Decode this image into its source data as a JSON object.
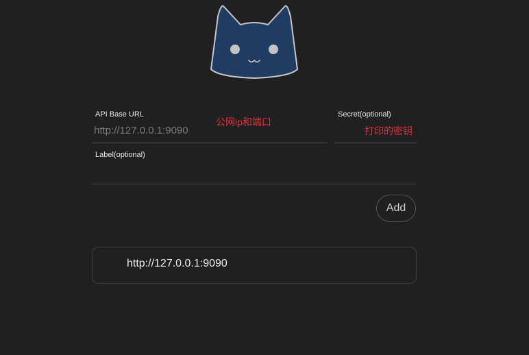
{
  "form": {
    "api_base_url": {
      "label": "API Base URL",
      "placeholder": "http://127.0.0.1:9090",
      "value": "",
      "annotation": "公网ip和端口"
    },
    "secret": {
      "label": "Secret(optional)",
      "placeholder": "",
      "value": "",
      "annotation": "打印的密钥"
    },
    "label": {
      "label": "Label(optional)",
      "placeholder": "",
      "value": ""
    },
    "add_button_label": "Add"
  },
  "backends": [
    {
      "url": "http://127.0.0.1:9090"
    }
  ],
  "colors": {
    "background": "#202020",
    "logo_fill": "#1f3d63",
    "logo_outline": "#c7c7c7",
    "annotation": "#e0303a"
  },
  "icons": {
    "logo": "cat-logo-icon"
  }
}
